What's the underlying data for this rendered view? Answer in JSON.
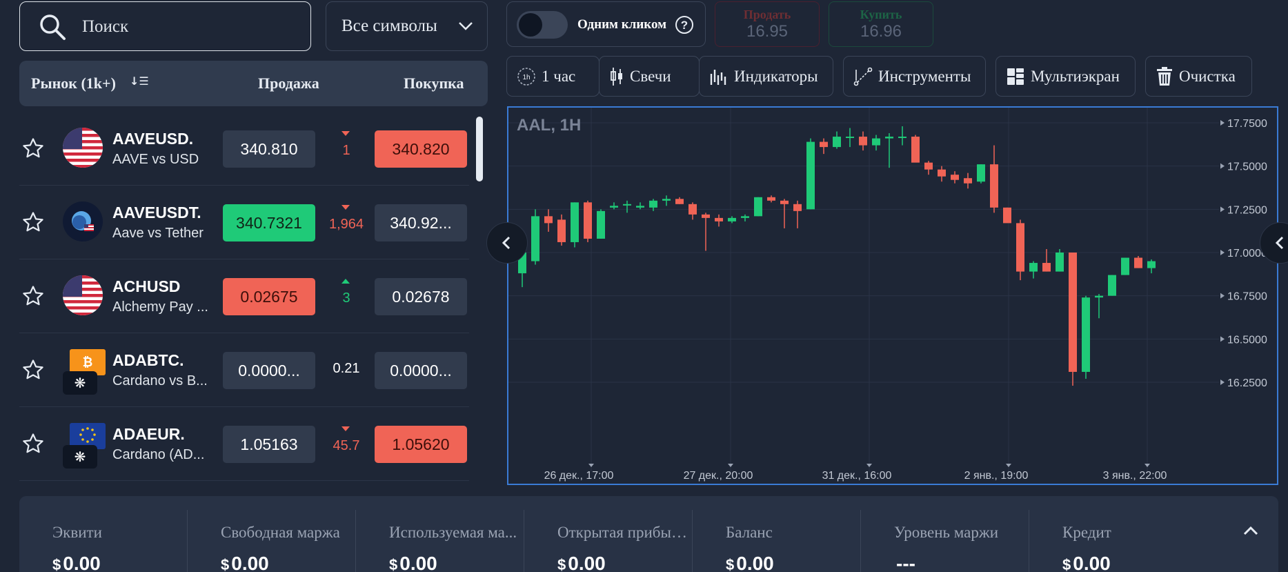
{
  "search": {
    "placeholder": "Поиск"
  },
  "symbol_filter": {
    "selected": "Все символы"
  },
  "market_header": {
    "market": "Рынок (1k+)",
    "sort_icon": "↓☰",
    "sell": "Продажа",
    "buy": "Покупка"
  },
  "markets": [
    {
      "symbol": "AAVEUSD.",
      "description": "AAVE vs USD",
      "flag": "us-flag-icon",
      "sell": "340.810",
      "sell_style": "neutral",
      "spread": "1",
      "spread_dir": "down",
      "buy": "340.820",
      "buy_style": "red"
    },
    {
      "symbol": "AAVEUSDT.",
      "description": "Aave vs Tether",
      "flag": "aave-icon",
      "sell": "340.7321",
      "sell_style": "green",
      "spread": "1,964",
      "spread_dir": "down",
      "buy": "340.92...",
      "buy_style": "neutral"
    },
    {
      "symbol": "ACHUSD",
      "description": "Alchemy Pay ...",
      "flag": "us-flag-icon",
      "sell": "0.02675",
      "sell_style": "red",
      "spread": "3",
      "spread_dir": "up",
      "buy": "0.02678",
      "buy_style": "neutral"
    },
    {
      "symbol": "ADABTC.",
      "description": "Cardano vs B...",
      "flag": "bitcoin-icon",
      "sell": "0.0000...",
      "sell_style": "neutral",
      "spread": "0.21",
      "spread_dir": "none",
      "buy": "0.0000...",
      "buy_style": "neutral"
    },
    {
      "symbol": "ADAEUR.",
      "description": "Cardano (AD...",
      "flag": "eu-flag-icon",
      "sell": "1.05163",
      "sell_style": "neutral",
      "spread": "45.7",
      "spread_dir": "down",
      "buy": "1.05620",
      "buy_style": "red"
    }
  ],
  "one_click": {
    "label": "Одним кликом",
    "enabled": false
  },
  "trade": {
    "sell_label": "Продать",
    "sell_price": "16.95",
    "buy_label": "Купить",
    "buy_price": "16.96"
  },
  "toolbar": [
    {
      "label": "1 час",
      "icon": "timeframe-icon"
    },
    {
      "label": "Свечи",
      "icon": "candles-icon"
    },
    {
      "label": "Индикаторы",
      "icon": "indicators-icon"
    },
    {
      "label": "Инструменты",
      "icon": "drawing-tools-icon"
    },
    {
      "label": "Мультиэкран",
      "icon": "multiscreen-icon"
    },
    {
      "label": "Очистка",
      "icon": "trash-icon"
    }
  ],
  "colors": {
    "up": "#1fca78",
    "down": "#f06456",
    "accent": "#3a7bd5",
    "background": "#1e2636"
  },
  "chart_data": {
    "type": "candlestick",
    "title": "AAL, 1H",
    "grid": true,
    "y_ticks": [
      17.75,
      17.5,
      17.25,
      17.0,
      16.75,
      16.5,
      16.25
    ],
    "ylim": [
      16.2,
      17.79
    ],
    "x_ticks": [
      "26 дек., 17:00",
      "27 дек., 20:00",
      "31 дек., 16:00",
      "2 янв., 19:00",
      "3 янв., 22:00"
    ],
    "candles": [
      [
        16.88,
        17.02,
        16.8,
        17.0
      ],
      [
        16.95,
        17.25,
        16.93,
        17.21
      ],
      [
        17.21,
        17.25,
        17.12,
        17.17
      ],
      [
        17.19,
        17.22,
        17.04,
        17.06
      ],
      [
        17.06,
        17.29,
        17.03,
        17.29
      ],
      [
        17.29,
        17.3,
        17.06,
        17.08
      ],
      [
        17.08,
        17.25,
        17.08,
        17.24
      ],
      [
        17.26,
        17.29,
        17.25,
        17.27
      ],
      [
        17.28,
        17.3,
        17.23,
        17.28
      ],
      [
        17.26,
        17.29,
        17.25,
        17.27
      ],
      [
        17.26,
        17.31,
        17.24,
        17.3
      ],
      [
        17.3,
        17.33,
        17.27,
        17.31
      ],
      [
        17.31,
        17.32,
        17.28,
        17.28
      ],
      [
        17.28,
        17.29,
        17.19,
        17.22
      ],
      [
        17.22,
        17.23,
        17.01,
        17.2
      ],
      [
        17.2,
        17.22,
        17.15,
        17.18
      ],
      [
        17.18,
        17.21,
        17.17,
        17.2
      ],
      [
        17.2,
        17.22,
        17.18,
        17.21
      ],
      [
        17.21,
        17.32,
        17.21,
        17.32
      ],
      [
        17.32,
        17.33,
        17.29,
        17.3
      ],
      [
        17.3,
        17.31,
        17.14,
        17.28
      ],
      [
        17.28,
        17.3,
        17.14,
        17.24
      ],
      [
        17.25,
        17.66,
        17.25,
        17.64
      ],
      [
        17.64,
        17.66,
        17.57,
        17.61
      ],
      [
        17.61,
        17.7,
        17.6,
        17.67
      ],
      [
        17.67,
        17.72,
        17.61,
        17.67
      ],
      [
        17.67,
        17.7,
        17.59,
        17.62
      ],
      [
        17.62,
        17.68,
        17.59,
        17.66
      ],
      [
        17.66,
        17.69,
        17.49,
        17.67
      ],
      [
        17.67,
        17.73,
        17.62,
        17.67
      ],
      [
        17.67,
        17.68,
        17.54,
        17.52
      ],
      [
        17.52,
        17.53,
        17.45,
        17.48
      ],
      [
        17.48,
        17.5,
        17.41,
        17.44
      ],
      [
        17.45,
        17.47,
        17.4,
        17.42
      ],
      [
        17.43,
        17.46,
        17.37,
        17.4
      ],
      [
        17.41,
        17.51,
        17.4,
        17.51
      ],
      [
        17.51,
        17.62,
        17.23,
        17.26
      ],
      [
        17.26,
        17.26,
        17.18,
        17.17
      ],
      [
        17.17,
        17.19,
        16.84,
        16.89
      ],
      [
        16.89,
        16.95,
        16.85,
        16.94
      ],
      [
        16.94,
        17.02,
        16.89,
        16.89
      ],
      [
        16.89,
        17.02,
        16.89,
        17.0
      ],
      [
        17.0,
        17.0,
        16.23,
        16.31
      ],
      [
        16.31,
        16.75,
        16.27,
        16.74
      ],
      [
        16.74,
        16.76,
        16.62,
        16.75
      ],
      [
        16.75,
        16.87,
        16.75,
        16.87
      ],
      [
        16.87,
        16.97,
        16.87,
        16.97
      ],
      [
        16.97,
        16.98,
        16.91,
        16.91
      ],
      [
        16.91,
        16.96,
        16.88,
        16.95
      ]
    ]
  },
  "stats": [
    {
      "label": "Эквити",
      "currency": "$",
      "value": "0.00"
    },
    {
      "label": "Свободная маржа",
      "currency": "$",
      "value": "0.00"
    },
    {
      "label": "Используемая ма...",
      "currency": "$",
      "value": "0.00"
    },
    {
      "label": "Открытая прибыл...",
      "currency": "$",
      "value": "0.00"
    },
    {
      "label": "Баланс",
      "currency": "$",
      "value": "0.00"
    },
    {
      "label": "Уровень маржи",
      "currency": "",
      "value": "---"
    },
    {
      "label": "Кредит",
      "currency": "$",
      "value": "0.00"
    }
  ]
}
